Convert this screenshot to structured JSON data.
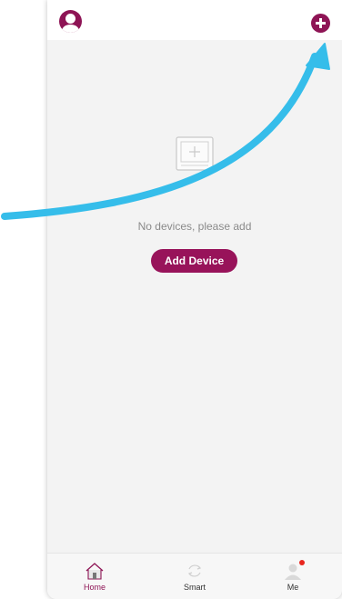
{
  "header": {
    "avatar_icon": "user-avatar-icon",
    "add_icon": "plus-circle-icon"
  },
  "empty_state": {
    "icon": "empty-device-box-icon",
    "message": "No devices, please add",
    "button_label": "Add Device"
  },
  "tabs": [
    {
      "label": "Home",
      "icon": "home-icon",
      "active": true
    },
    {
      "label": "Smart",
      "icon": "refresh-icon",
      "active": false
    },
    {
      "label": "Me",
      "icon": "person-icon",
      "active": false,
      "badge": true
    }
  ],
  "colors": {
    "brand": "#8e1455",
    "button": "#98135a",
    "arrow": "#35bdea",
    "badge": "#e8261e"
  },
  "annotation": {
    "icon": "pointer-arrow-icon"
  }
}
